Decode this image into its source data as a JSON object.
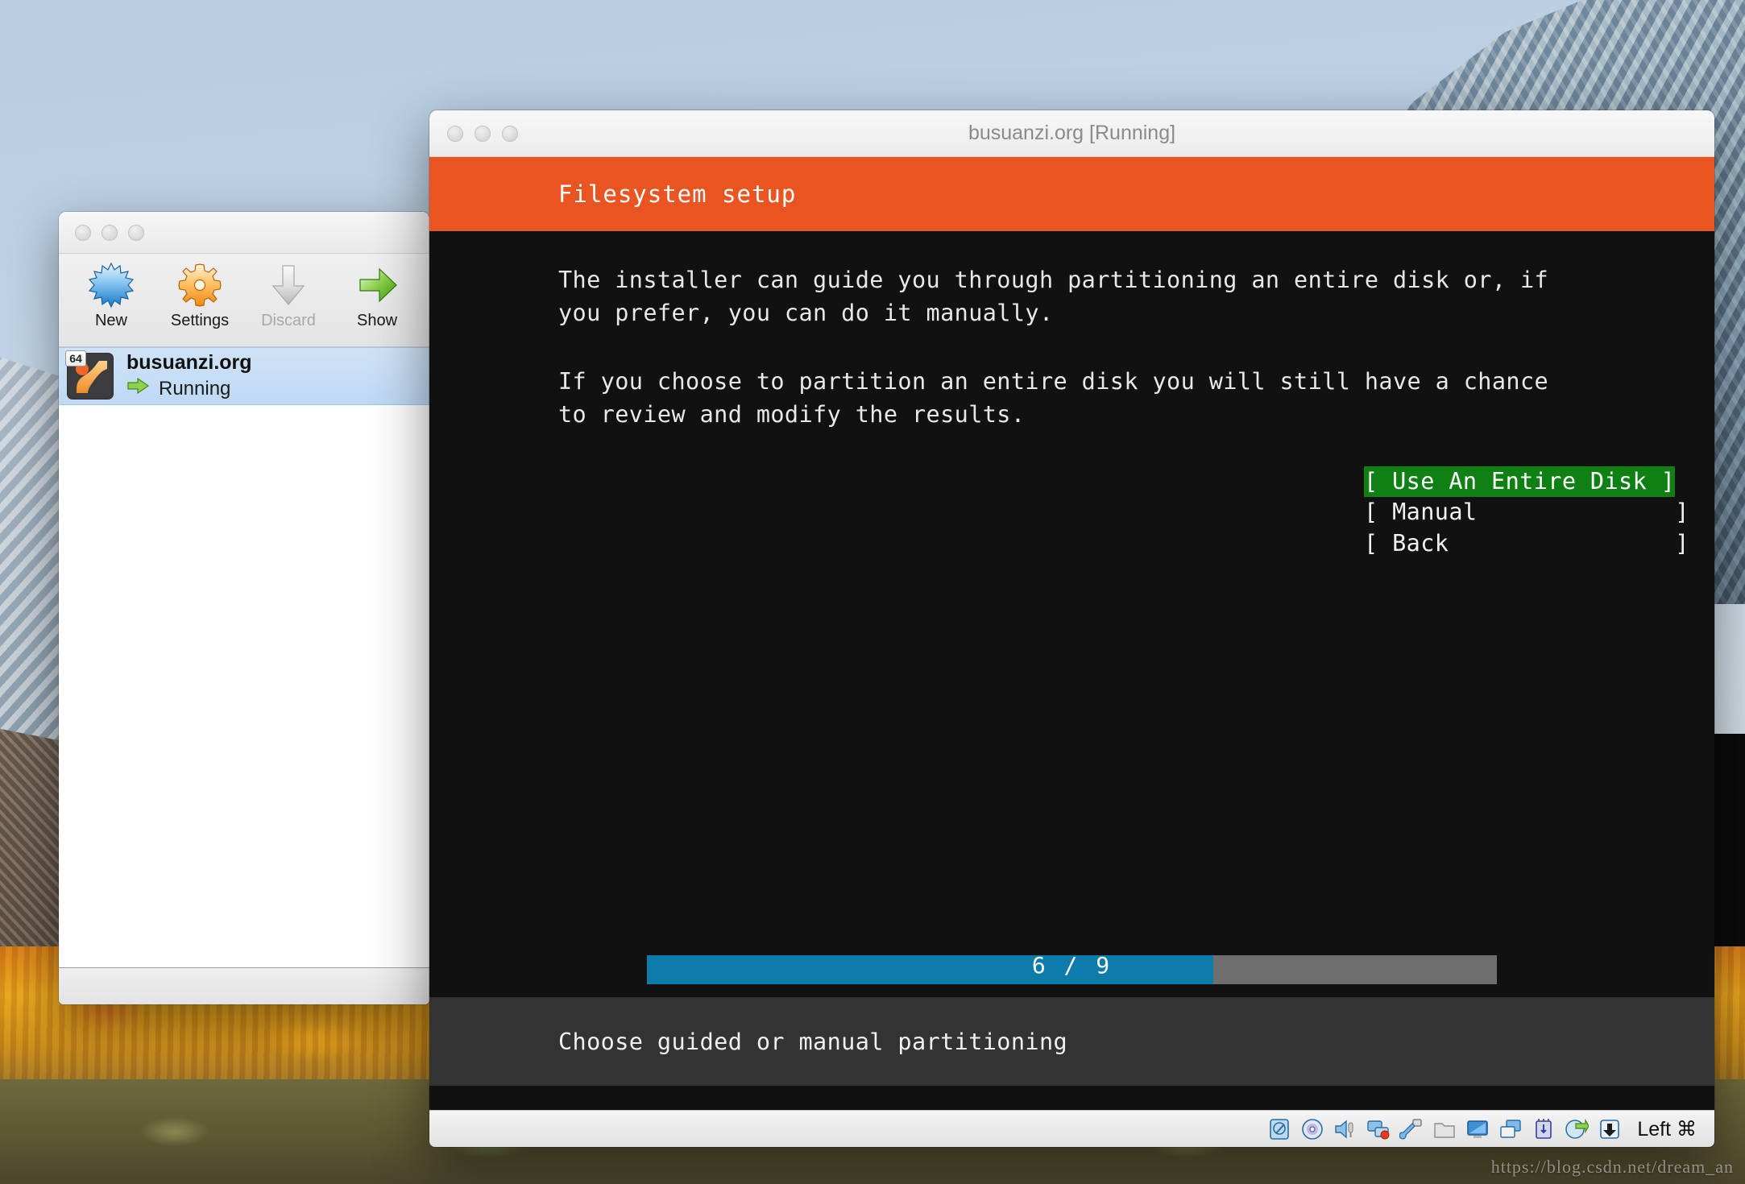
{
  "desktop": {
    "watermark": "https://blog.csdn.net/dream_an"
  },
  "manager_window": {
    "traffic_lights": [
      "close-button",
      "minimize-button",
      "zoom-button"
    ],
    "toolbar": [
      {
        "label": "New",
        "icon": "new-star-icon",
        "disabled": false
      },
      {
        "label": "Settings",
        "icon": "settings-gear-icon",
        "disabled": false
      },
      {
        "label": "Discard",
        "icon": "discard-arrow-icon",
        "disabled": true
      },
      {
        "label": "Show",
        "icon": "show-arrow-icon",
        "disabled": false
      }
    ],
    "vm_list": [
      {
        "name": "busuanzi.org",
        "state": "Running",
        "arch_badge": "64",
        "state_icon": "green-arrow-icon",
        "selected": true
      }
    ]
  },
  "vm_window": {
    "title": "busuanzi.org [Running]",
    "traffic_lights": [
      "close-button",
      "minimize-button",
      "zoom-button"
    ],
    "installer": {
      "header_title": "Filesystem setup",
      "header_color": "#e95420",
      "paragraphs": [
        "The installer can guide you through partitioning an entire disk or, if\nyou prefer, you can do it manually.",
        "If you choose to partition an entire disk you will still have a chance\nto review and modify the results."
      ],
      "menu": [
        {
          "label": "[ Use An Entire Disk ]",
          "selected": true
        },
        {
          "label": "[ Manual              ]",
          "selected": false
        },
        {
          "label": "[ Back                ]",
          "selected": false
        }
      ],
      "progress": {
        "label": "6 / 9",
        "current": 6,
        "total": 9,
        "fill_color": "#0e7cab",
        "track_color": "#6e6e6e"
      },
      "footer_text": "Choose guided or manual partitioning",
      "selected_color": "#0f8013"
    },
    "statusbar": {
      "icons": [
        "hard-disk-icon",
        "optical-disc-icon",
        "audio-icon",
        "network-icon",
        "usb-icon",
        "shared-folder-icon",
        "display-icon",
        "video-capture-icon",
        "cpu-icon",
        "remote-display-icon",
        "host-key-arrow-icon"
      ],
      "host_key": "Left ⌘"
    }
  }
}
